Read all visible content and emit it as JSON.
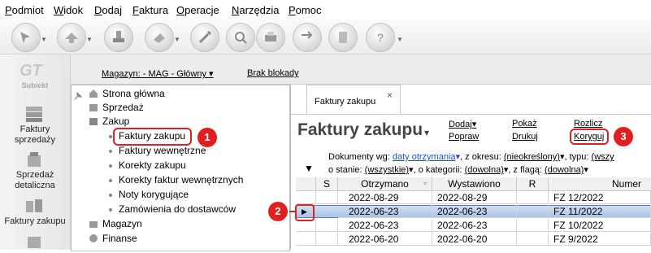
{
  "menu": [
    "Podmiot",
    "Widok",
    "Dodaj",
    "Faktura",
    "Operacje",
    "Narzędzia",
    "Pomoc"
  ],
  "app_logo": "Subiekt",
  "left_rail": [
    {
      "label": "Faktury sprzedaży",
      "icon": "invoice-stack-icon"
    },
    {
      "label": "Sprzedaż detaliczna",
      "icon": "cash-register-icon"
    },
    {
      "label": "Faktury zakupu",
      "icon": "purchase-invoice-icon"
    }
  ],
  "info_strip": {
    "warehouse": "Magazyn: - MAG - Główny",
    "lock": "Brak blokady"
  },
  "tree": {
    "items": [
      {
        "label": "Strona główna",
        "type": "root"
      },
      {
        "label": "Sprzedaż",
        "type": "root"
      },
      {
        "label": "Zakup",
        "type": "root"
      },
      {
        "label": "Faktury zakupu",
        "type": "child"
      },
      {
        "label": "Faktury wewnętrzne",
        "type": "child"
      },
      {
        "label": "Korekty zakupu",
        "type": "child"
      },
      {
        "label": "Korekty faktur wewnętrznych",
        "type": "child"
      },
      {
        "label": "Noty korygujące",
        "type": "child"
      },
      {
        "label": "Zamówienia do dostawców",
        "type": "child"
      },
      {
        "label": "Magazyn",
        "type": "root"
      },
      {
        "label": "Finanse",
        "type": "root"
      }
    ]
  },
  "tab": {
    "label": "Faktury zakupu",
    "close": "×"
  },
  "heading": "Faktury zakupu",
  "actions": {
    "dodaj": "Dodaj",
    "popraw": "Popraw",
    "pokaz": "Pokaż",
    "drukuj": "Drukuj",
    "rozlicz": "Rozlicz",
    "koryguj": "Koryguj"
  },
  "filters": {
    "documents_by": "Dokumenty wg:",
    "documents_by_value": "daty otrzymania",
    "period": ", z okresu:",
    "period_value": "(nieokreślony)",
    "type": ", typu:",
    "type_value": "(wszy",
    "state": "o stanie:",
    "state_value": "(wszystkie)",
    "category": ", o kategorii:",
    "category_value": "(dowolna)",
    "flag": ", z flagą:",
    "flag_value": "(dowolna)"
  },
  "grid": {
    "columns": [
      "S",
      "Otrzymano",
      "Wystawiono",
      "R",
      "Numer"
    ],
    "rows": [
      {
        "otrzymano": "2022-08-29",
        "wystawiono": "2022-08-29",
        "numer": "FZ 12/2022",
        "selected": false
      },
      {
        "otrzymano": "2022-06-23",
        "wystawiono": "2022-06-23",
        "numer": "FZ 11/2022",
        "selected": true
      },
      {
        "otrzymano": "2022-06-23",
        "wystawiono": "2022-06-23",
        "numer": "FZ 10/2022",
        "selected": false
      },
      {
        "otrzymano": "2022-06-20",
        "wystawiono": "2022-06-20",
        "numer": "FZ 9/2022",
        "selected": false
      }
    ]
  },
  "callouts": [
    "1",
    "2",
    "3"
  ],
  "colors": {
    "callout": "#e02020",
    "selected_row": "#b8cdea",
    "link_blue": "#1f4fcc"
  }
}
